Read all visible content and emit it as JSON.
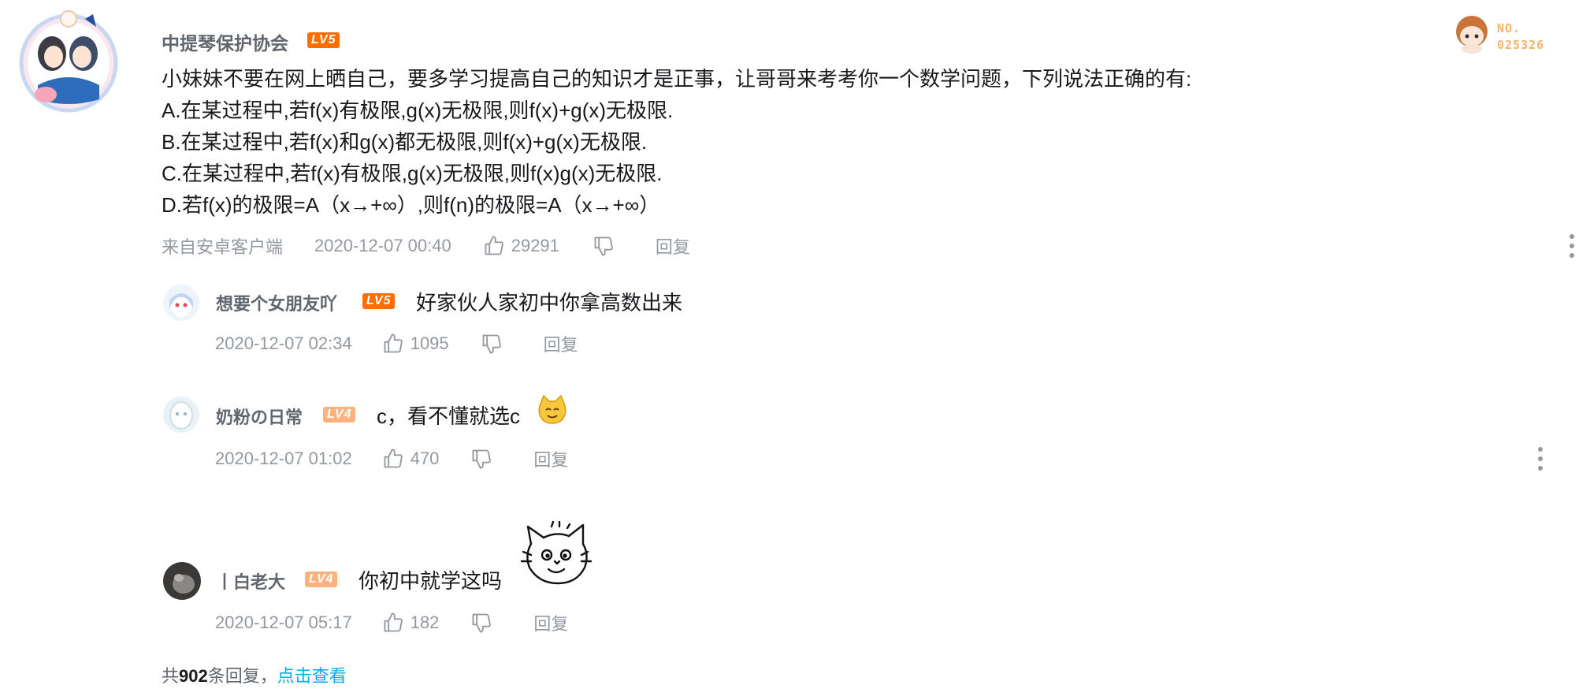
{
  "main_comment": {
    "username": "中提琴保护协会",
    "level": "LV5",
    "content_lines": [
      "小妹妹不要在网上晒自己，要多学习提高自己的知识才是正事，让哥哥来考考你一个数学问题，下列说法正确的有:",
      "A.在某过程中,若f(x)有极限,g(x)无极限,则f(x)+g(x)无极限.",
      "B.在某过程中,若f(x)和g(x)都无极限,则f(x)+g(x)无极限.",
      "C.在某过程中,若f(x)有极限,g(x)无极限,则f(x)g(x)无极限.",
      "D.若f(x)的极限=A（x→+∞）,则f(n)的极限=A（x→+∞）"
    ],
    "source": "来自安卓客户端",
    "time": "2020-12-07 00:40",
    "likes": "29291",
    "reply_label": "回复",
    "badge_no": "NO.",
    "badge_number": "025326"
  },
  "replies": [
    {
      "username": "想要个女朋友吖",
      "level": "LV5",
      "content": "好家伙人家初中你拿高数出来",
      "time": "2020-12-07 02:34",
      "likes": "1095",
      "reply_label": "回复"
    },
    {
      "username": "奶粉の日常",
      "level": "LV4",
      "content": "c，看不懂就选c",
      "time": "2020-12-07 01:02",
      "likes": "470",
      "reply_label": "回复"
    },
    {
      "username": "丨白老大",
      "level": "LV4",
      "content": "你初中就学这吗",
      "time": "2020-12-07 05:17",
      "likes": "182",
      "reply_label": "回复"
    }
  ],
  "footer": {
    "prefix": "共",
    "count": "902",
    "suffix": "条回复，",
    "link": "点击查看"
  },
  "colors": {
    "accent_link": "#00aeec",
    "level5": "#ff6c00",
    "level4": "#ffb27f",
    "meta_gray": "#9499a0"
  }
}
